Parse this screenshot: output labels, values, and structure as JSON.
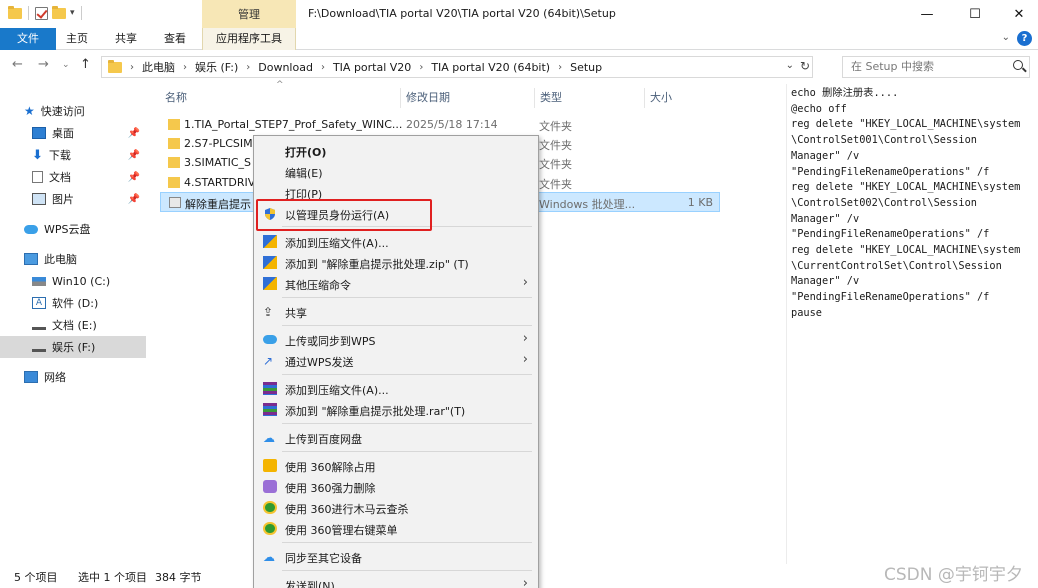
{
  "window": {
    "title": "F:\\Download\\TIA portal V20\\TIA portal V20 (64bit)\\Setup",
    "manage_tab": "管理",
    "minimize": "—",
    "maximize": "☐",
    "close": "✕"
  },
  "ribbon": {
    "tabs": [
      "文件",
      "主页",
      "共享",
      "查看",
      "应用程序工具"
    ]
  },
  "address": {
    "crumbs": [
      "此电脑",
      "娱乐 (F:)",
      "Download",
      "TIA portal V20",
      "TIA portal V20 (64bit)",
      "Setup"
    ],
    "search_placeholder": "在 Setup 中搜索"
  },
  "nav": {
    "items": [
      {
        "label": "快速访问",
        "icon": "star-icon",
        "pinned": false
      },
      {
        "label": "桌面",
        "icon": "desktop-icon",
        "pinned": true
      },
      {
        "label": "下载",
        "icon": "download-icon",
        "pinned": true
      },
      {
        "label": "文档",
        "icon": "document-icon",
        "pinned": true
      },
      {
        "label": "图片",
        "icon": "picture-icon",
        "pinned": true
      },
      {
        "label": "WPS云盘",
        "icon": "cloud-icon",
        "pinned": false
      },
      {
        "label": "此电脑",
        "icon": "computer-icon",
        "pinned": false
      },
      {
        "label": "Win10 (C:)",
        "icon": "drive-icon",
        "pinned": false
      },
      {
        "label": "软件 (D:)",
        "icon": "drive-icon",
        "pinned": false
      },
      {
        "label": "文档 (E:)",
        "icon": "drive-icon",
        "pinned": false
      },
      {
        "label": "娱乐 (F:)",
        "icon": "drive-icon",
        "pinned": false,
        "selected": true
      },
      {
        "label": "网络",
        "icon": "network-icon",
        "pinned": false
      }
    ]
  },
  "columns": {
    "name": "名称",
    "date": "修改日期",
    "type": "类型",
    "size": "大小"
  },
  "files": [
    {
      "name": "1.TIA_Portal_STEP7_Prof_Safety_WINC...",
      "date": "2025/5/18 17:14",
      "type": "文件夹",
      "size": ""
    },
    {
      "name": "2.S7-PLCSIM",
      "date": "",
      "type": "文件夹",
      "size": ""
    },
    {
      "name": "3.SIMATIC_S",
      "date": "",
      "type": "文件夹",
      "size": ""
    },
    {
      "name": "4.STARTDRIV",
      "date": "",
      "type": "文件夹",
      "size": ""
    },
    {
      "name": "解除重启提示",
      "date": "",
      "type": "Windows 批处理...",
      "size": "1 KB"
    }
  ],
  "preview_lines": [
    "echo 删除注册表....",
    "@echo off",
    "reg delete \"HKEY_LOCAL_MACHINE\\system",
    "\\ControlSet001\\Control\\Session",
    "Manager\" /v",
    "\"PendingFileRenameOperations\" /f",
    "reg delete \"HKEY_LOCAL_MACHINE\\system",
    "\\ControlSet002\\Control\\Session",
    "Manager\" /v",
    "\"PendingFileRenameOperations\" /f",
    "reg delete \"HKEY_LOCAL_MACHINE\\system",
    "\\CurrentControlSet\\Control\\Session",
    "Manager\" /v",
    "\"PendingFileRenameOperations\" /f",
    "pause"
  ],
  "status": {
    "count": "5 个项目",
    "selected": "选中 1 个项目",
    "size": "384 字节"
  },
  "context_menu": {
    "open": "打开(O)",
    "edit": "编辑(E)",
    "print": "打印(P)",
    "run_as_admin": "以管理员身份运行(A)",
    "add_archive": "添加到压缩文件(A)...",
    "add_zip": "添加到 \"解除重启提示批处理.zip\" (T)",
    "other_compress": "其他压缩命令",
    "share": "共享",
    "wps_sync": "上传或同步到WPS",
    "wps_send": "通过WPS发送",
    "rar_add": "添加到压缩文件(A)...",
    "rar_add_named": "添加到 \"解除重启提示批处理.rar\"(T)",
    "baidu": "上传到百度网盘",
    "unlock360": "使用 360解除占用",
    "delete360": "使用 360强力删除",
    "scan360": "使用 360进行木马云查杀",
    "menu360": "使用 360管理右键菜单",
    "sync_devices": "同步至其它设备",
    "send_to": "发送到(N)"
  },
  "watermark": "CSDN @宇钶宇夕",
  "colors": {
    "file_tab": "#1979ca",
    "manage_tab": "#f7e7b6",
    "selection": "#cce8ff",
    "highlight_box": "#e02020"
  }
}
